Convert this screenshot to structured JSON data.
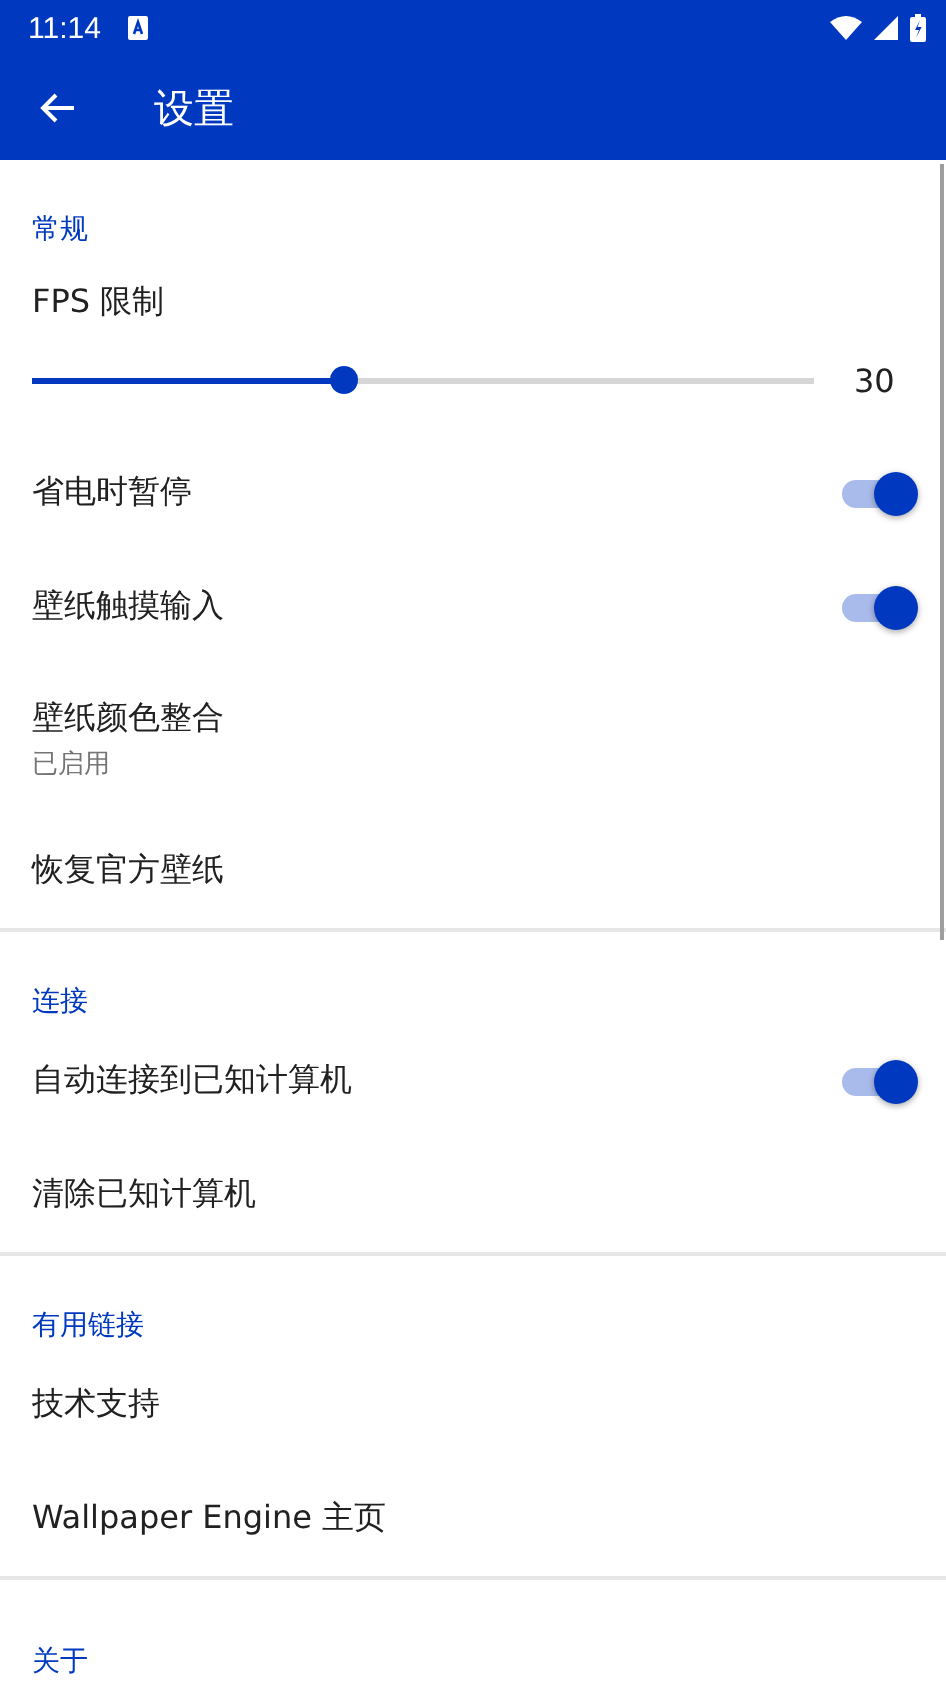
{
  "status_bar": {
    "time": "11:14"
  },
  "toolbar": {
    "title": "设置"
  },
  "sections": [
    {
      "header": "常规",
      "items": [
        {
          "kind": "slider",
          "title": "FPS 限制",
          "level": 0.4,
          "reading": "30"
        },
        {
          "kind": "switch",
          "title": "省电时暂停",
          "checked": true
        },
        {
          "kind": "switch",
          "title": "壁纸触摸输入",
          "checked": true
        },
        {
          "kind": "plain",
          "title": "壁纸颜色整合",
          "summary": "已启用"
        },
        {
          "kind": "plain",
          "title": "恢复官方壁纸"
        }
      ]
    },
    {
      "header": "连接",
      "items": [
        {
          "kind": "switch",
          "title": "自动连接到已知计算机",
          "checked": true
        },
        {
          "kind": "plain",
          "title": "清除已知计算机"
        }
      ]
    },
    {
      "header": "有用链接",
      "items": [
        {
          "kind": "plain",
          "title": "技术支持"
        },
        {
          "kind": "plain",
          "title": "Wallpaper Engine 主页"
        }
      ]
    },
    {
      "header": "关于"
    }
  ]
}
